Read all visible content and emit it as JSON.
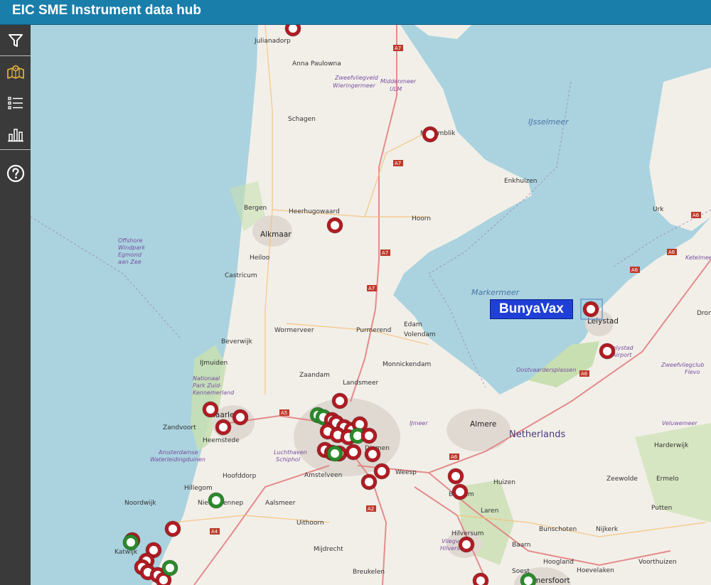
{
  "app": {
    "title": "EIC SME Instrument data hub"
  },
  "sidebar": {
    "items": [
      {
        "name": "filter-icon",
        "active": false
      },
      {
        "name": "map-icon",
        "active": true
      },
      {
        "name": "list-icon",
        "active": false
      },
      {
        "name": "bar-chart-icon",
        "active": false
      },
      {
        "name": "help-icon",
        "active": false
      }
    ]
  },
  "tooltip": {
    "label": "BunyaVax"
  },
  "colors": {
    "header": "#1a7eab",
    "sidebar": "#3a3a3a",
    "marker_red": "#b01c23",
    "marker_green": "#2b8a2b",
    "tooltip": "#1f3fd6",
    "water": "#aad3df",
    "land": "#f2efe9"
  },
  "labels": {
    "julianadorp": "Julianadorp",
    "anna_paulowna": "Anna Paulowna",
    "zweefvliegveld_w": "Zweefvliegveld",
    "wieringermeer": "Wieringermeer",
    "middenmeer": "Middenmeer",
    "ulm": "ULM",
    "schagen": "Schagen",
    "medemblik": "Medemblik",
    "ijsselmeer": "IJsselmeer",
    "enkhuizen": "Enkhuizen",
    "bergen": "Bergen",
    "heerhugowaard": "Heerhugowaard",
    "hoorn": "Hoorn",
    "alkmaar": "Alkmaar",
    "heiloo": "Heiloo",
    "offshore1": "Offshore",
    "offshore2": "Windpark",
    "offshore3": "Egmond",
    "offshore4": "aan Zee",
    "castricum": "Castricum",
    "markermeer": "Markermeer",
    "lelystad": "Lelystad",
    "wormerveer": "Wormerveer",
    "purmerend": "Purmerend",
    "edam": "Edam",
    "volendam": "Volendam",
    "beverwijk": "Beverwijk",
    "ijmuiden": "IJmuiden",
    "monnickendam": "Monnickendam",
    "zaandam": "Zaandam",
    "landsmeer": "Landsmeer",
    "oostvaarders": "Oostvaardersplassen",
    "nationaal1": "Nationaal",
    "nationaal2": "Park Zuid-",
    "nationaal3": "Kennemerland",
    "haarlem": "Haarlem",
    "zandvoort": "Zandvoort",
    "heemstede": "Heemstede",
    "almere": "Almere",
    "netherlands": "Netherlands",
    "amsterdamse1": "Amsterdamse",
    "amsterdamse2": "Waterleidingduinen",
    "luchthaven1": "Luchthaven",
    "luchthaven2": "Schiphol",
    "hoofddorp": "Hoofddorp",
    "amstelveen": "Amstelveen",
    "weesp": "Weesp",
    "huizen": "Huizen",
    "hillegom": "Hillegom",
    "nieuw_vennep": "Nieuw-Vennep",
    "aalsmeer": "Aalsmeer",
    "laren": "Laren",
    "noordwijk": "Noordwijk",
    "uithoorn": "Uithoorn",
    "bunschoten": "Bunschoten",
    "nijkerk": "Nijkerk",
    "katwijk": "Katwijk",
    "mijdrecht": "Mijdrecht",
    "hilversum": "Hilversum",
    "baarn": "Baarn",
    "breukelen": "Breukelen",
    "soest": "Soest",
    "amersfoort": "Amersfoort",
    "hoogland": "Hoogland",
    "hoevelaken": "Hoevelaken",
    "voorthuizen": "Voorthuizen",
    "putten": "Putten",
    "ermelo": "Ermelo",
    "harderwijk": "Harderwijk",
    "zeewolde": "Zeewolde",
    "urk": "Urk",
    "ketelmeer": "Ketelmeer",
    "dronten": "Dron",
    "zweefvliegclub1": "Zweefvliegclub",
    "zweefvliegclub2": "Flevo",
    "lelystad_ap1": "Lelystad",
    "lelystad_ap2": "Airport",
    "veluwemeer": "Veluwemeer",
    "ijmeer": "IJmeer",
    "diemen": "Diemen",
    "bussum": "Bussum",
    "vliegveld1": "Vliegveld",
    "vliegveld2": "Hilversum",
    "a7": "A7",
    "a6": "A6",
    "a5": "A5",
    "a4": "A4",
    "a2": "A2"
  }
}
